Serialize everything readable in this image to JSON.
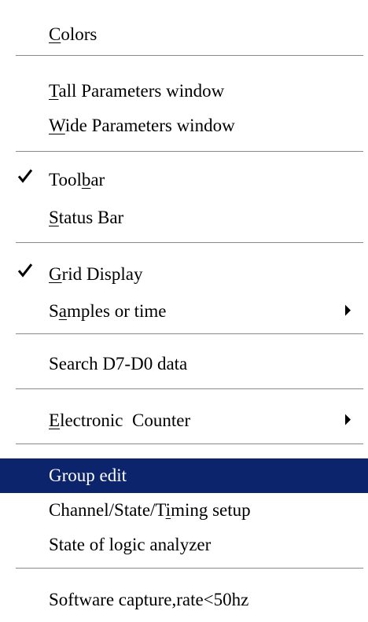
{
  "menu": {
    "colors": {
      "pre": "",
      "key": "C",
      "post": "olors"
    },
    "tall_params": {
      "pre": "",
      "key": "T",
      "post": "all Parameters window"
    },
    "wide_params": {
      "pre": "",
      "key": "W",
      "post": "ide Parameters window"
    },
    "toolbar": {
      "pre": "Tool",
      "key": "b",
      "post": "ar",
      "checked": true
    },
    "status_bar": {
      "pre": "",
      "key": "S",
      "post": "tatus Bar"
    },
    "grid_display": {
      "pre": "",
      "key": "G",
      "post": "rid Display",
      "checked": true
    },
    "samples_or_time": {
      "pre": "S",
      "key": "a",
      "post": "mples or time",
      "submenu": true
    },
    "search_data": {
      "label": "Search D7-D0 data"
    },
    "electronic_counter": {
      "pre": "",
      "key": "E",
      "post": "lectronic  Counter",
      "submenu": true
    },
    "group_edit": {
      "label": "Group edit",
      "selected": true
    },
    "channel_setup": {
      "pre": "Channel/State/T",
      "key": "i",
      "post": "ming setup"
    },
    "state_of_la": {
      "label": "State of logic analyzer"
    },
    "software_capture": {
      "label": "Software capture,rate<50hz"
    }
  },
  "colors": {
    "highlight": "#0b246b",
    "highlight_text": "#ffffff",
    "text": "#000000",
    "separator": "#8a8a8a"
  },
  "icons": {
    "check": "checkmark-icon",
    "submenu": "submenu-arrow-icon"
  }
}
